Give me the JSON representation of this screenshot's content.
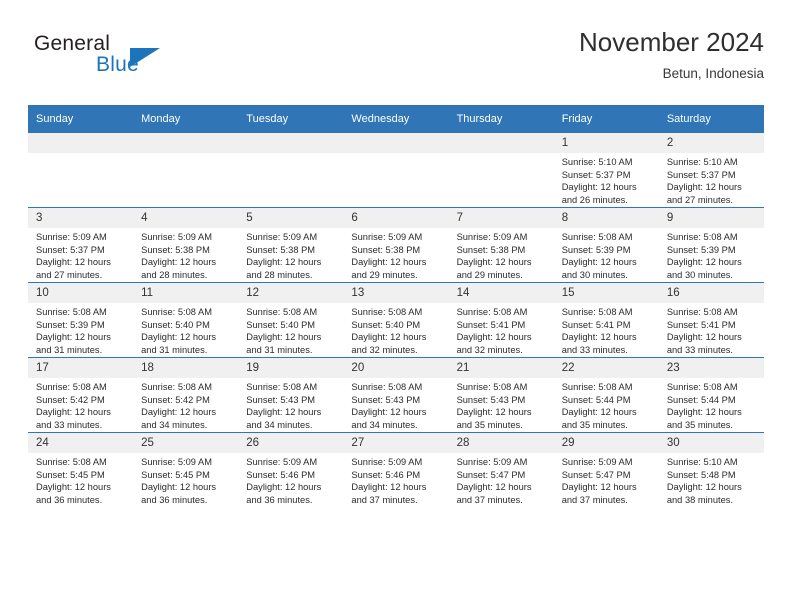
{
  "brand": {
    "name_part1": "General",
    "name_part2": "Blue"
  },
  "header": {
    "title": "November 2024",
    "subtitle": "Betun, Indonesia"
  },
  "colors": {
    "header_blue": "#3075b6",
    "brand_blue": "#1c75bc",
    "daynum_band": "#f0f0f0"
  },
  "weekday_headers": [
    "Sunday",
    "Monday",
    "Tuesday",
    "Wednesday",
    "Thursday",
    "Friday",
    "Saturday"
  ],
  "weeks": [
    [
      {
        "day": "",
        "empty": true
      },
      {
        "day": "",
        "empty": true
      },
      {
        "day": "",
        "empty": true
      },
      {
        "day": "",
        "empty": true
      },
      {
        "day": "",
        "empty": true
      },
      {
        "day": "1",
        "sunrise": "Sunrise: 5:10 AM",
        "sunset": "Sunset: 5:37 PM",
        "daylight_line1": "Daylight: 12 hours",
        "daylight_line2": "and 26 minutes."
      },
      {
        "day": "2",
        "sunrise": "Sunrise: 5:10 AM",
        "sunset": "Sunset: 5:37 PM",
        "daylight_line1": "Daylight: 12 hours",
        "daylight_line2": "and 27 minutes."
      }
    ],
    [
      {
        "day": "3",
        "sunrise": "Sunrise: 5:09 AM",
        "sunset": "Sunset: 5:37 PM",
        "daylight_line1": "Daylight: 12 hours",
        "daylight_line2": "and 27 minutes."
      },
      {
        "day": "4",
        "sunrise": "Sunrise: 5:09 AM",
        "sunset": "Sunset: 5:38 PM",
        "daylight_line1": "Daylight: 12 hours",
        "daylight_line2": "and 28 minutes."
      },
      {
        "day": "5",
        "sunrise": "Sunrise: 5:09 AM",
        "sunset": "Sunset: 5:38 PM",
        "daylight_line1": "Daylight: 12 hours",
        "daylight_line2": "and 28 minutes."
      },
      {
        "day": "6",
        "sunrise": "Sunrise: 5:09 AM",
        "sunset": "Sunset: 5:38 PM",
        "daylight_line1": "Daylight: 12 hours",
        "daylight_line2": "and 29 minutes."
      },
      {
        "day": "7",
        "sunrise": "Sunrise: 5:09 AM",
        "sunset": "Sunset: 5:38 PM",
        "daylight_line1": "Daylight: 12 hours",
        "daylight_line2": "and 29 minutes."
      },
      {
        "day": "8",
        "sunrise": "Sunrise: 5:08 AM",
        "sunset": "Sunset: 5:39 PM",
        "daylight_line1": "Daylight: 12 hours",
        "daylight_line2": "and 30 minutes."
      },
      {
        "day": "9",
        "sunrise": "Sunrise: 5:08 AM",
        "sunset": "Sunset: 5:39 PM",
        "daylight_line1": "Daylight: 12 hours",
        "daylight_line2": "and 30 minutes."
      }
    ],
    [
      {
        "day": "10",
        "sunrise": "Sunrise: 5:08 AM",
        "sunset": "Sunset: 5:39 PM",
        "daylight_line1": "Daylight: 12 hours",
        "daylight_line2": "and 31 minutes."
      },
      {
        "day": "11",
        "sunrise": "Sunrise: 5:08 AM",
        "sunset": "Sunset: 5:40 PM",
        "daylight_line1": "Daylight: 12 hours",
        "daylight_line2": "and 31 minutes."
      },
      {
        "day": "12",
        "sunrise": "Sunrise: 5:08 AM",
        "sunset": "Sunset: 5:40 PM",
        "daylight_line1": "Daylight: 12 hours",
        "daylight_line2": "and 31 minutes."
      },
      {
        "day": "13",
        "sunrise": "Sunrise: 5:08 AM",
        "sunset": "Sunset: 5:40 PM",
        "daylight_line1": "Daylight: 12 hours",
        "daylight_line2": "and 32 minutes."
      },
      {
        "day": "14",
        "sunrise": "Sunrise: 5:08 AM",
        "sunset": "Sunset: 5:41 PM",
        "daylight_line1": "Daylight: 12 hours",
        "daylight_line2": "and 32 minutes."
      },
      {
        "day": "15",
        "sunrise": "Sunrise: 5:08 AM",
        "sunset": "Sunset: 5:41 PM",
        "daylight_line1": "Daylight: 12 hours",
        "daylight_line2": "and 33 minutes."
      },
      {
        "day": "16",
        "sunrise": "Sunrise: 5:08 AM",
        "sunset": "Sunset: 5:41 PM",
        "daylight_line1": "Daylight: 12 hours",
        "daylight_line2": "and 33 minutes."
      }
    ],
    [
      {
        "day": "17",
        "sunrise": "Sunrise: 5:08 AM",
        "sunset": "Sunset: 5:42 PM",
        "daylight_line1": "Daylight: 12 hours",
        "daylight_line2": "and 33 minutes."
      },
      {
        "day": "18",
        "sunrise": "Sunrise: 5:08 AM",
        "sunset": "Sunset: 5:42 PM",
        "daylight_line1": "Daylight: 12 hours",
        "daylight_line2": "and 34 minutes."
      },
      {
        "day": "19",
        "sunrise": "Sunrise: 5:08 AM",
        "sunset": "Sunset: 5:43 PM",
        "daylight_line1": "Daylight: 12 hours",
        "daylight_line2": "and 34 minutes."
      },
      {
        "day": "20",
        "sunrise": "Sunrise: 5:08 AM",
        "sunset": "Sunset: 5:43 PM",
        "daylight_line1": "Daylight: 12 hours",
        "daylight_line2": "and 34 minutes."
      },
      {
        "day": "21",
        "sunrise": "Sunrise: 5:08 AM",
        "sunset": "Sunset: 5:43 PM",
        "daylight_line1": "Daylight: 12 hours",
        "daylight_line2": "and 35 minutes."
      },
      {
        "day": "22",
        "sunrise": "Sunrise: 5:08 AM",
        "sunset": "Sunset: 5:44 PM",
        "daylight_line1": "Daylight: 12 hours",
        "daylight_line2": "and 35 minutes."
      },
      {
        "day": "23",
        "sunrise": "Sunrise: 5:08 AM",
        "sunset": "Sunset: 5:44 PM",
        "daylight_line1": "Daylight: 12 hours",
        "daylight_line2": "and 35 minutes."
      }
    ],
    [
      {
        "day": "24",
        "sunrise": "Sunrise: 5:08 AM",
        "sunset": "Sunset: 5:45 PM",
        "daylight_line1": "Daylight: 12 hours",
        "daylight_line2": "and 36 minutes."
      },
      {
        "day": "25",
        "sunrise": "Sunrise: 5:09 AM",
        "sunset": "Sunset: 5:45 PM",
        "daylight_line1": "Daylight: 12 hours",
        "daylight_line2": "and 36 minutes."
      },
      {
        "day": "26",
        "sunrise": "Sunrise: 5:09 AM",
        "sunset": "Sunset: 5:46 PM",
        "daylight_line1": "Daylight: 12 hours",
        "daylight_line2": "and 36 minutes."
      },
      {
        "day": "27",
        "sunrise": "Sunrise: 5:09 AM",
        "sunset": "Sunset: 5:46 PM",
        "daylight_line1": "Daylight: 12 hours",
        "daylight_line2": "and 37 minutes."
      },
      {
        "day": "28",
        "sunrise": "Sunrise: 5:09 AM",
        "sunset": "Sunset: 5:47 PM",
        "daylight_line1": "Daylight: 12 hours",
        "daylight_line2": "and 37 minutes."
      },
      {
        "day": "29",
        "sunrise": "Sunrise: 5:09 AM",
        "sunset": "Sunset: 5:47 PM",
        "daylight_line1": "Daylight: 12 hours",
        "daylight_line2": "and 37 minutes."
      },
      {
        "day": "30",
        "sunrise": "Sunrise: 5:10 AM",
        "sunset": "Sunset: 5:48 PM",
        "daylight_line1": "Daylight: 12 hours",
        "daylight_line2": "and 38 minutes."
      }
    ]
  ]
}
